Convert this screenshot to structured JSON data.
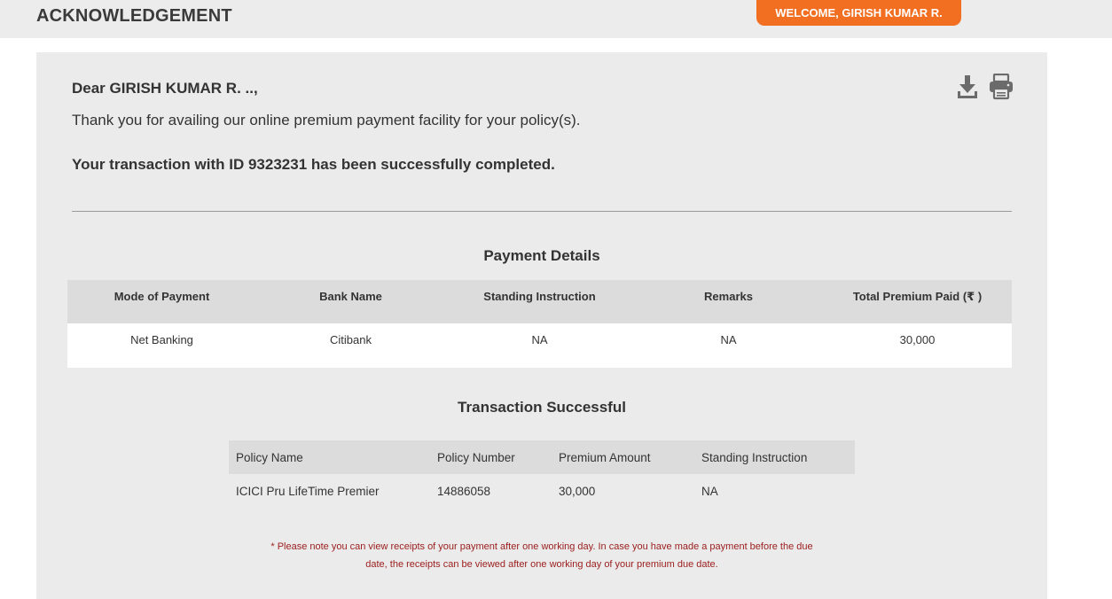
{
  "header": {
    "title": "ACKNOWLEDGEMENT",
    "welcome": "WELCOME, GIRISH KUMAR R."
  },
  "message": {
    "greeting": "Dear GIRISH KUMAR R. ..,",
    "thanks": "Thank you for availing our online premium payment facility for your policy(s).",
    "transaction": "Your transaction with ID 9323231 has been successfully completed."
  },
  "toolbar": {
    "download_icon": "download-icon",
    "print_icon": "print-icon"
  },
  "payment_details": {
    "title": "Payment Details",
    "headers": [
      "Mode of Payment",
      "Bank Name",
      "Standing Instruction",
      "Remarks",
      "Total Premium Paid (₹ )"
    ],
    "row": [
      "Net Banking",
      "Citibank",
      "NA",
      "NA",
      "30,000"
    ]
  },
  "transaction_result": {
    "title": "Transaction Successful",
    "headers": [
      "Policy Name",
      "Policy Number",
      "Premium Amount",
      "Standing Instruction"
    ],
    "rows": [
      [
        "ICICI Pru LifeTime Premier",
        "14886058",
        "30,000",
        "NA"
      ]
    ]
  },
  "note": {
    "line1": "* Please note you can view receipts of your payment after one working day. In case you have made a payment before the due",
    "line2": "date, the receipts can be viewed after one working day of your premium due date."
  },
  "colors": {
    "accent": "#f26f21",
    "note": "#9b1c1c",
    "card": "#ebebeb",
    "table_header": "#dcdcdc"
  }
}
